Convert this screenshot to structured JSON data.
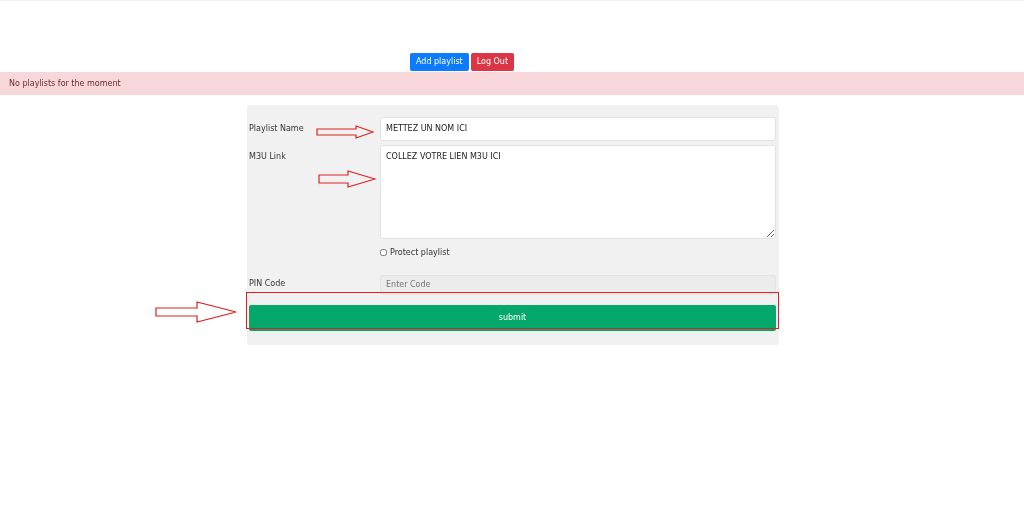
{
  "header_buttons": [
    {
      "label": "Add playlist",
      "kind": "primary"
    },
    {
      "label": "Log Out",
      "kind": "danger"
    }
  ],
  "alert": {
    "text": "No playlists for the moment"
  },
  "form": {
    "fields": [
      {
        "label": "Playlist Name",
        "kind": "text",
        "value": "METTEZ UN NOM ICI"
      },
      {
        "label": "M3U Link",
        "kind": "textarea",
        "value": "COLLEZ VOTRE LIEN M3U ICI"
      },
      {
        "label": "Protect playlist",
        "kind": "checkbox",
        "checked": false
      },
      {
        "label": "PIN Code",
        "kind": "text",
        "placeholder": "Enter Code",
        "disabled": true
      }
    ],
    "submit": {
      "label": "submit"
    }
  }
}
